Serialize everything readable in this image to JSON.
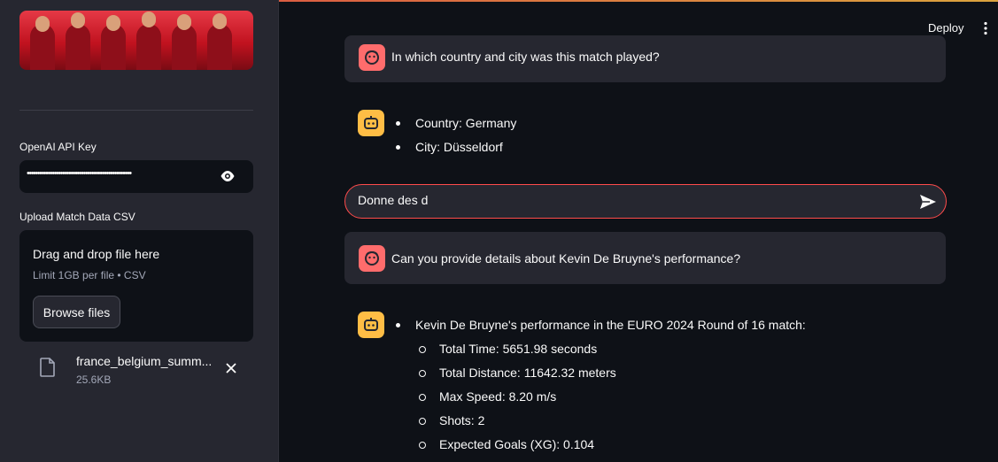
{
  "sidebar": {
    "api_key_label": "OpenAI API Key",
    "api_key_value": "••••••••••••••••••••••••••••••••••••••••••••••••••",
    "upload_label": "Upload Match Data CSV",
    "dropzone": {
      "title": "Drag and drop file here",
      "limit": "Limit 1GB per file • CSV",
      "browse_label": "Browse files"
    },
    "file": {
      "name": "france_belgium_summ...",
      "size": "25.6KB"
    }
  },
  "header": {
    "deploy_label": "Deploy"
  },
  "chat": {
    "q1": "In which country and city was this match played?",
    "a1": [
      "Country: Germany",
      "City: Düsseldorf"
    ],
    "input_value": "Donne des d",
    "q2": "Can you provide details about Kevin De Bruyne's performance?",
    "a2_intro": "Kevin De Bruyne's performance in the EURO 2024 Round of 16 match:",
    "a2_stats": [
      "Total Time: 5651.98 seconds",
      "Total Distance: 11642.32 meters",
      "Max Speed: 8.20 m/s",
      "Shots: 2",
      "Expected Goals (XG): 0.104"
    ]
  },
  "icons": {
    "eye": "eye-icon",
    "file": "file-icon",
    "close": "close-icon",
    "send": "send-icon",
    "menu": "kebab-menu-icon",
    "user_avatar": "user-avatar-icon",
    "bot_avatar": "bot-avatar-icon"
  },
  "colors": {
    "accent": "#ff4b4b",
    "user_avatar": "#ff6c6c",
    "bot_avatar": "#ffbd45",
    "sidebar_bg": "#262730",
    "main_bg": "#0e1117"
  }
}
